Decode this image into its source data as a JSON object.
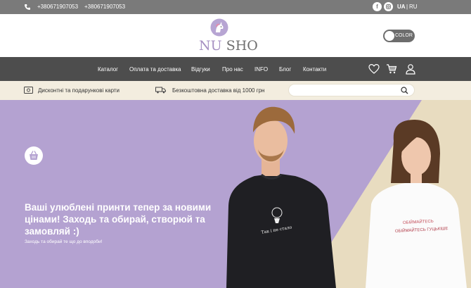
{
  "topbar": {
    "phone1": "+380671907053",
    "phone2": "+380671907053",
    "social": [
      "facebook-icon",
      "instagram-icon"
    ],
    "lang_ua": "UA",
    "lang_sep": "|",
    "lang_ru": "RU"
  },
  "header": {
    "logo_nu": "NU ",
    "logo_sho": "SHO",
    "toggle_label": "COLOR"
  },
  "nav": {
    "items": [
      "Каталог",
      "Оплата та доставка",
      "Відгуки",
      "Про нас",
      "INFO",
      "Блог",
      "Контакти"
    ],
    "icons": [
      "heart-icon",
      "cart-icon",
      "user-icon"
    ]
  },
  "infobar": {
    "cards_text": "Дисконтні та подарункові карти",
    "delivery_text": "Безкоштовна доставка від 1000 грн",
    "search_placeholder": ""
  },
  "hero": {
    "title": "Ваші улюблені принти тепер за новими цінами! Заходь та обирай, створюй та замовляй :)",
    "subtitle": "Заходь та обирай  те що до вподоби!",
    "shirt_print_left": "Так і не стало",
    "shirt_print_right_1": "ОБІЙМАЙТЕСЬ",
    "shirt_print_right_2": "ОБІЙМАЙТЕСЬ ГУЦЬКІШЕ"
  },
  "colors": {
    "topbar": "#7a7a7a",
    "nav": "#4d4d4d",
    "infobar": "#f3eddf",
    "hero_purple": "#b4a2d1",
    "hero_beige": "#e8dcc0"
  }
}
